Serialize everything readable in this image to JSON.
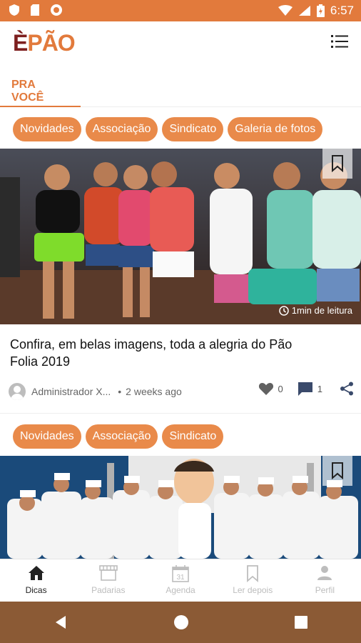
{
  "status": {
    "time": "6:57",
    "bar_color": "#e27a3c"
  },
  "app": {
    "logo_e": "È",
    "logo_rest": "PÃO",
    "brand_orange": "#e27a3c",
    "brand_dark": "#7d1f1f"
  },
  "tabs": [
    {
      "label": "PRA VOCÊ",
      "active": true
    }
  ],
  "posts": [
    {
      "chips": [
        "Novidades",
        "Associação",
        "Sindicato",
        "Galeria de fotos"
      ],
      "read_time": "1min de leitura",
      "title": "Confira, em belas imagens, toda a alegria do Pão Folia 2019",
      "author": "Administrador X...",
      "date_sep": "•",
      "date": "2 weeks ago",
      "likes": "0",
      "comments": "1"
    },
    {
      "chips": [
        "Novidades",
        "Associação",
        "Sindicato"
      ]
    }
  ],
  "bottom_nav": [
    {
      "label": "Dicas",
      "icon": "home-icon",
      "active": true
    },
    {
      "label": "Padarias",
      "icon": "store-icon",
      "active": false
    },
    {
      "label": "Agenda",
      "icon": "calendar-icon",
      "active": false,
      "calendar_day": "31"
    },
    {
      "label": "Ler depois",
      "icon": "bookmark-icon",
      "active": false
    },
    {
      "label": "Perfil",
      "icon": "person-icon",
      "active": false
    }
  ],
  "system_nav": {
    "bar_color": "#8b5a35"
  }
}
